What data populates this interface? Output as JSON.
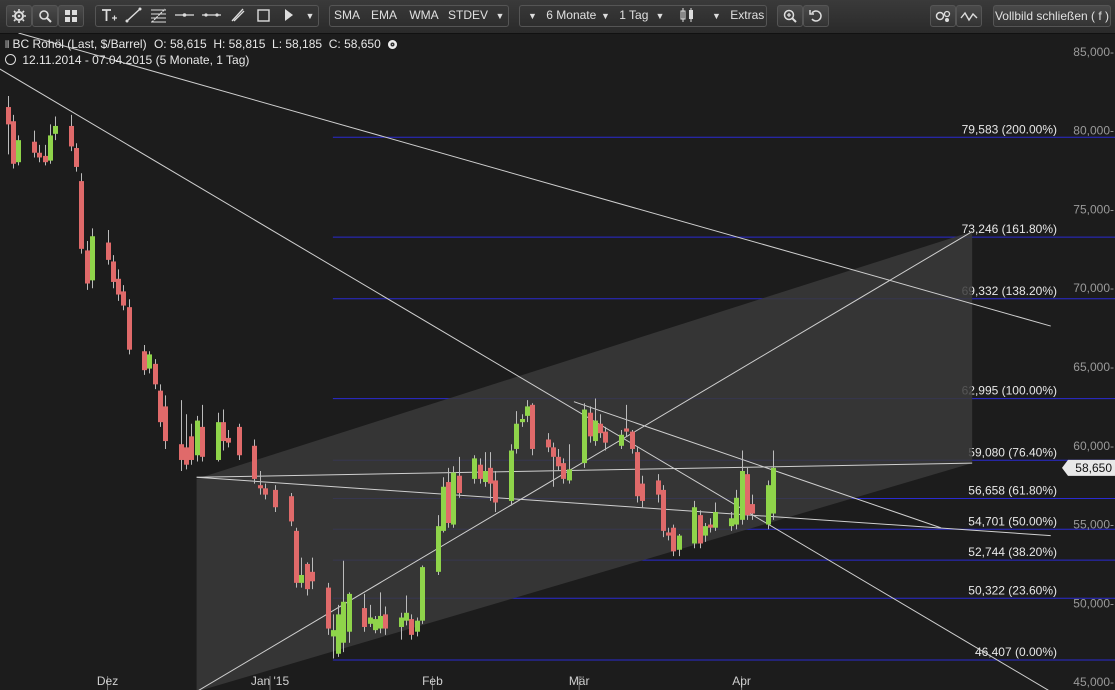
{
  "toolbar": {
    "sma": "SMA",
    "ema": "EMA",
    "wma": "WMA",
    "stdev": "STDEV",
    "period": "6 Monate",
    "interval": "1 Tag",
    "extras": "Extras",
    "fullscreen": "Vollbild schließen ( f )",
    "icons": [
      "gear-icon",
      "search-icon",
      "grid-icon",
      "text-tool-icon",
      "trendline-icon",
      "fibonacci-icon",
      "horizontal-line-icon",
      "channel-icon",
      "brush-icon",
      "rectangle-icon",
      "pointer-icon",
      "candlestick-type-icon",
      "zoom-in-icon",
      "undo-icon",
      "settings-icon",
      "indicator-wave-icon"
    ]
  },
  "header": {
    "instrument": "BC Rohöl (Last, $/Barrel)",
    "ohlc": "O: 58,615  H: 58,815  L: 58,185  C: 58,650",
    "range": "12.11.2014 - 07.04.2015 (5 Monate, 1 Tag)"
  },
  "colors": {
    "background": "#1c1c1c",
    "up": "#8fd44a",
    "down": "#e06a6a",
    "fib_line": "#2a2ad0",
    "trendline": "#cfcfcf"
  },
  "chart_data": {
    "type": "candlestick",
    "y_axis": {
      "min": 44.5,
      "max": 86.2,
      "ticks": [
        45,
        50,
        55,
        60,
        65,
        70,
        75,
        80,
        85
      ],
      "tick_labels": [
        "45,000-",
        "50,000-",
        "55,000-",
        "60,000-",
        "65,000-",
        "70,000-",
        "75,000-",
        "80,000-",
        "85,000-"
      ]
    },
    "x_axis": {
      "start": "2014-11-12",
      "end": "2015-04-07",
      "labels": [
        {
          "label": "Dez",
          "date": "2014-12-01"
        },
        {
          "label": "Jan '15",
          "date": "2015-01-01"
        },
        {
          "label": "Feb",
          "date": "2015-02-01"
        },
        {
          "label": "Mär",
          "date": "2015-03-01"
        },
        {
          "label": "Apr",
          "date": "2015-04-01"
        }
      ]
    },
    "last_price": "58,650",
    "fib_levels": [
      {
        "value": 79.583,
        "label": "79,583 (200.00%)"
      },
      {
        "value": 73.246,
        "label": "73,246 (161.80%)"
      },
      {
        "value": 69.332,
        "label": "69,332 (138.20%)"
      },
      {
        "value": 62.995,
        "label": "62,995 (100.00%)"
      },
      {
        "value": 59.08,
        "label": "59,080 (76.40%)"
      },
      {
        "value": 56.658,
        "label": "56,658 (61.80%)"
      },
      {
        "value": 54.701,
        "label": "54,701 (50.00%)"
      },
      {
        "value": 52.744,
        "label": "52,744 (38.20%)"
      },
      {
        "value": 50.322,
        "label": "50,322 (23.60%)"
      },
      {
        "value": 46.407,
        "label": "46,407 (0.00%)"
      }
    ],
    "fib_start_date": "2015-01-13",
    "candles": [
      {
        "d": "2014-11-12",
        "o": 81.5,
        "h": 82.2,
        "c": 80.4,
        "l": 78.5
      },
      {
        "d": "2014-11-13",
        "o": 80.6,
        "h": 81.0,
        "c": 77.9,
        "l": 77.6
      },
      {
        "d": "2014-11-14",
        "o": 78.0,
        "h": 79.7,
        "c": 79.4,
        "l": 77.8
      },
      {
        "d": "2014-11-17",
        "o": 79.3,
        "h": 80.0,
        "c": 78.6,
        "l": 78.3
      },
      {
        "d": "2014-11-18",
        "o": 78.6,
        "h": 79.1,
        "c": 78.3,
        "l": 78.0
      },
      {
        "d": "2014-11-19",
        "o": 78.4,
        "h": 79.1,
        "c": 78.0,
        "l": 77.8
      },
      {
        "d": "2014-11-20",
        "o": 78.1,
        "h": 80.4,
        "c": 79.7,
        "l": 77.9
      },
      {
        "d": "2014-11-21",
        "o": 79.8,
        "h": 80.9,
        "c": 80.3,
        "l": 79.4
      },
      {
        "d": "2014-11-24",
        "o": 80.3,
        "h": 81.0,
        "c": 79.0,
        "l": 78.7
      },
      {
        "d": "2014-11-25",
        "o": 78.9,
        "h": 79.2,
        "c": 77.7,
        "l": 77.4
      },
      {
        "d": "2014-11-26",
        "o": 76.8,
        "h": 77.3,
        "c": 72.5,
        "l": 72.2
      },
      {
        "d": "2014-11-27",
        "o": 72.4,
        "h": 73.0,
        "c": 70.3,
        "l": 69.9
      },
      {
        "d": "2014-11-28",
        "o": 70.5,
        "h": 73.8,
        "c": 73.3,
        "l": 70.0
      },
      {
        "d": "2014-12-01",
        "o": 72.9,
        "h": 73.7,
        "c": 71.8,
        "l": 71.5
      },
      {
        "d": "2014-12-02",
        "o": 71.7,
        "h": 72.1,
        "c": 70.4,
        "l": 70.0
      },
      {
        "d": "2014-12-03",
        "o": 70.6,
        "h": 71.2,
        "c": 69.6,
        "l": 69.2
      },
      {
        "d": "2014-12-04",
        "o": 69.8,
        "h": 70.2,
        "c": 68.9,
        "l": 68.6
      },
      {
        "d": "2014-12-05",
        "o": 68.8,
        "h": 69.3,
        "c": 66.1,
        "l": 65.8
      },
      {
        "d": "2014-12-08",
        "o": 66.0,
        "h": 66.4,
        "c": 64.8,
        "l": 64.5
      },
      {
        "d": "2014-12-09",
        "o": 64.9,
        "h": 66.0,
        "c": 65.8,
        "l": 64.6
      },
      {
        "d": "2014-12-10",
        "o": 65.2,
        "h": 65.5,
        "c": 63.9,
        "l": 63.6
      },
      {
        "d": "2014-12-11",
        "o": 63.5,
        "h": 63.9,
        "c": 61.5,
        "l": 61.2
      },
      {
        "d": "2014-12-12",
        "o": 62.5,
        "h": 63.2,
        "c": 60.3,
        "l": 59.8
      },
      {
        "d": "2014-12-15",
        "o": 60.1,
        "h": 62.9,
        "c": 59.1,
        "l": 58.4
      },
      {
        "d": "2014-12-16",
        "o": 59.9,
        "h": 62.0,
        "c": 58.8,
        "l": 58.5
      },
      {
        "d": "2014-12-17",
        "o": 60.6,
        "h": 61.4,
        "c": 59.1,
        "l": 58.8
      },
      {
        "d": "2014-12-18",
        "o": 59.4,
        "h": 61.9,
        "c": 61.6,
        "l": 59.0
      },
      {
        "d": "2014-12-19",
        "o": 61.2,
        "h": 62.6,
        "c": 59.3,
        "l": 59.0
      },
      {
        "d": "2014-12-22",
        "o": 59.1,
        "h": 62.1,
        "c": 61.5,
        "l": 59.0
      },
      {
        "d": "2014-12-23",
        "o": 61.5,
        "h": 62.3,
        "c": 60.3,
        "l": 59.7
      },
      {
        "d": "2014-12-24",
        "o": 60.5,
        "h": 61.0,
        "c": 60.2,
        "l": 59.9
      },
      {
        "d": "2014-12-26",
        "o": 61.2,
        "h": 61.4,
        "c": 59.4,
        "l": 59.1
      },
      {
        "d": "2014-12-29",
        "o": 60.0,
        "h": 60.4,
        "c": 57.9,
        "l": 57.6
      },
      {
        "d": "2014-12-30",
        "o": 57.5,
        "h": 58.4,
        "c": 57.3,
        "l": 56.9
      },
      {
        "d": "2014-12-31",
        "o": 57.3,
        "h": 57.6,
        "c": 56.9,
        "l": 56.6
      },
      {
        "d": "2015-01-02",
        "o": 57.2,
        "h": 57.5,
        "c": 56.1,
        "l": 55.8
      },
      {
        "d": "2015-01-05",
        "o": 56.8,
        "h": 57.0,
        "c": 55.2,
        "l": 54.9
      },
      {
        "d": "2015-01-06",
        "o": 54.6,
        "h": 54.8,
        "c": 51.3,
        "l": 51.0
      },
      {
        "d": "2015-01-07",
        "o": 51.3,
        "h": 52.9,
        "c": 51.8,
        "l": 51.0
      },
      {
        "d": "2015-01-08",
        "o": 52.5,
        "h": 52.6,
        "c": 50.9,
        "l": 50.5
      },
      {
        "d": "2015-01-09",
        "o": 52.0,
        "h": 52.9,
        "c": 51.4,
        "l": 50.9
      },
      {
        "d": "2015-01-12",
        "o": 51.0,
        "h": 51.3,
        "c": 48.4,
        "l": 48.0
      },
      {
        "d": "2015-01-13",
        "o": 47.9,
        "h": 49.3,
        "c": 48.3,
        "l": 46.5
      },
      {
        "d": "2015-01-14",
        "o": 46.8,
        "h": 49.9,
        "c": 49.3,
        "l": 46.6
      },
      {
        "d": "2015-01-15",
        "o": 47.5,
        "h": 52.7,
        "c": 50.1,
        "l": 46.9
      },
      {
        "d": "2015-01-16",
        "o": 48.2,
        "h": 50.7,
        "c": 50.6,
        "l": 47.5
      },
      {
        "d": "2015-01-19",
        "o": 49.7,
        "h": 50.6,
        "c": 48.5,
        "l": 48.2
      },
      {
        "d": "2015-01-20",
        "o": 48.7,
        "h": 49.9,
        "c": 49.1,
        "l": 48.5
      },
      {
        "d": "2015-01-21",
        "o": 48.3,
        "h": 49.2,
        "c": 49.0,
        "l": 48.1
      },
      {
        "d": "2015-01-22",
        "o": 48.4,
        "h": 50.7,
        "c": 49.2,
        "l": 48.1
      },
      {
        "d": "2015-01-23",
        "o": 49.3,
        "h": 49.8,
        "c": 48.4,
        "l": 48.0
      },
      {
        "d": "2015-01-26",
        "o": 48.5,
        "h": 49.4,
        "c": 49.1,
        "l": 47.7
      },
      {
        "d": "2015-01-27",
        "o": 48.9,
        "h": 50.5,
        "c": 49.4,
        "l": 48.6
      },
      {
        "d": "2015-01-28",
        "o": 49.0,
        "h": 49.3,
        "c": 48.0,
        "l": 47.7
      },
      {
        "d": "2015-01-29",
        "o": 48.2,
        "h": 49.1,
        "c": 48.9,
        "l": 47.9
      },
      {
        "d": "2015-01-30",
        "o": 48.9,
        "h": 52.4,
        "c": 52.3,
        "l": 48.7
      },
      {
        "d": "2015-02-02",
        "o": 52.0,
        "h": 55.6,
        "c": 54.9,
        "l": 51.8
      },
      {
        "d": "2015-02-03",
        "o": 54.6,
        "h": 58.0,
        "c": 57.4,
        "l": 54.5
      },
      {
        "d": "2015-02-04",
        "o": 57.7,
        "h": 58.6,
        "c": 55.1,
        "l": 54.8
      },
      {
        "d": "2015-02-05",
        "o": 55.0,
        "h": 58.7,
        "c": 58.3,
        "l": 54.8
      },
      {
        "d": "2015-02-06",
        "o": 58.1,
        "h": 59.3,
        "c": 57.0,
        "l": 56.7
      },
      {
        "d": "2015-02-09",
        "o": 57.9,
        "h": 59.4,
        "c": 59.2,
        "l": 57.6
      },
      {
        "d": "2015-02-10",
        "o": 58.8,
        "h": 59.2,
        "c": 57.9,
        "l": 57.6
      },
      {
        "d": "2015-02-11",
        "o": 57.7,
        "h": 59.6,
        "c": 58.4,
        "l": 57.4
      },
      {
        "d": "2015-02-12",
        "o": 58.6,
        "h": 59.6,
        "c": 57.6,
        "l": 56.5
      },
      {
        "d": "2015-02-13",
        "o": 57.8,
        "h": 58.4,
        "c": 56.4,
        "l": 55.8
      },
      {
        "d": "2015-02-16",
        "o": 56.5,
        "h": 60.1,
        "c": 59.7,
        "l": 56.2
      },
      {
        "d": "2015-02-17",
        "o": 59.8,
        "h": 62.2,
        "c": 61.4,
        "l": 59.5
      },
      {
        "d": "2015-02-18",
        "o": 61.5,
        "h": 62.0,
        "c": 61.7,
        "l": 61.2
      },
      {
        "d": "2015-02-19",
        "o": 61.9,
        "h": 62.9,
        "c": 62.5,
        "l": 61.5
      },
      {
        "d": "2015-02-20",
        "o": 62.6,
        "h": 62.7,
        "c": 59.8,
        "l": 59.4
      },
      {
        "d": "2015-02-23",
        "o": 60.4,
        "h": 60.8,
        "c": 59.9,
        "l": 59.6
      },
      {
        "d": "2015-02-24",
        "o": 59.9,
        "h": 60.2,
        "c": 59.3,
        "l": 57.4
      },
      {
        "d": "2015-02-25",
        "o": 59.3,
        "h": 59.8,
        "c": 58.7,
        "l": 58.4
      },
      {
        "d": "2015-02-26",
        "o": 58.9,
        "h": 59.2,
        "c": 57.9,
        "l": 57.6
      },
      {
        "d": "2015-02-27",
        "o": 57.8,
        "h": 60.1,
        "c": 58.5,
        "l": 57.6
      },
      {
        "d": "2015-03-02",
        "o": 58.9,
        "h": 62.7,
        "c": 62.3,
        "l": 58.6
      },
      {
        "d": "2015-03-03",
        "o": 62.1,
        "h": 62.5,
        "c": 60.6,
        "l": 60.2
      },
      {
        "d": "2015-03-04",
        "o": 60.3,
        "h": 63.0,
        "c": 61.6,
        "l": 60.0
      },
      {
        "d": "2015-03-05",
        "o": 61.4,
        "h": 62.0,
        "c": 60.8,
        "l": 60.5
      },
      {
        "d": "2015-03-06",
        "o": 60.9,
        "h": 61.2,
        "c": 60.2,
        "l": 59.7
      },
      {
        "d": "2015-03-09",
        "o": 60.0,
        "h": 61.0,
        "c": 60.7,
        "l": 59.8
      },
      {
        "d": "2015-03-10",
        "o": 61.1,
        "h": 62.6,
        "c": 60.9,
        "l": 60.6
      },
      {
        "d": "2015-03-11",
        "o": 60.9,
        "h": 61.0,
        "c": 59.8,
        "l": 59.5
      },
      {
        "d": "2015-03-12",
        "o": 59.6,
        "h": 59.9,
        "c": 56.8,
        "l": 56.4
      },
      {
        "d": "2015-03-13",
        "o": 57.6,
        "h": 58.1,
        "c": 56.5,
        "l": 56.1
      },
      {
        "d": "2015-03-16",
        "o": 57.8,
        "h": 58.2,
        "c": 56.9,
        "l": 56.4
      },
      {
        "d": "2015-03-17",
        "o": 57.2,
        "h": 57.5,
        "c": 54.6,
        "l": 54.2
      },
      {
        "d": "2015-03-18",
        "o": 54.5,
        "h": 54.8,
        "c": 54.3,
        "l": 54.0
      },
      {
        "d": "2015-03-19",
        "o": 54.8,
        "h": 55.0,
        "c": 53.3,
        "l": 53.0
      },
      {
        "d": "2015-03-20",
        "o": 53.4,
        "h": 54.4,
        "c": 54.3,
        "l": 53.0
      },
      {
        "d": "2015-03-23",
        "o": 53.8,
        "h": 56.5,
        "c": 56.1,
        "l": 53.5
      },
      {
        "d": "2015-03-24",
        "o": 55.6,
        "h": 55.9,
        "c": 53.8,
        "l": 53.5
      },
      {
        "d": "2015-03-25",
        "o": 54.3,
        "h": 55.1,
        "c": 54.9,
        "l": 53.9
      },
      {
        "d": "2015-03-26",
        "o": 55.0,
        "h": 55.4,
        "c": 54.8,
        "l": 54.5
      },
      {
        "d": "2015-03-27",
        "o": 54.8,
        "h": 56.4,
        "c": 55.8,
        "l": 54.6
      },
      {
        "d": "2015-03-30",
        "o": 54.9,
        "h": 55.8,
        "c": 55.4,
        "l": 54.6
      },
      {
        "d": "2015-03-31",
        "o": 55.0,
        "h": 57.2,
        "c": 56.7,
        "l": 54.7
      },
      {
        "d": "2015-04-01",
        "o": 55.3,
        "h": 59.7,
        "c": 58.4,
        "l": 55.0
      },
      {
        "d": "2015-04-02",
        "o": 58.2,
        "h": 58.6,
        "c": 55.6,
        "l": 55.3
      },
      {
        "d": "2015-04-03",
        "o": 56.3,
        "h": 56.9,
        "c": 55.7,
        "l": 55.3
      },
      {
        "d": "2015-04-06",
        "o": 55.0,
        "h": 57.8,
        "c": 57.5,
        "l": 54.7
      },
      {
        "d": "2015-04-07",
        "o": 55.7,
        "h": 59.7,
        "c": 58.6,
        "l": 55.3
      }
    ]
  }
}
